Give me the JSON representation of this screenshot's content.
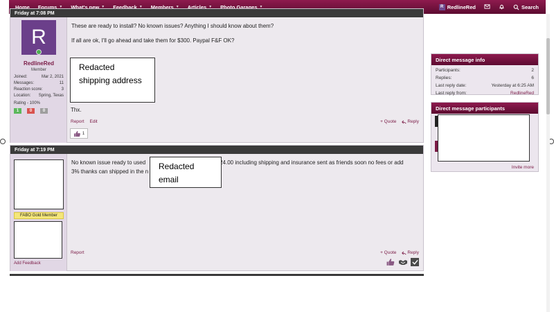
{
  "nav": {
    "items": [
      {
        "label": "Home",
        "dropdown": false
      },
      {
        "label": "Forums",
        "dropdown": true
      },
      {
        "label": "What's new",
        "dropdown": true
      },
      {
        "label": "Feedback",
        "dropdown": true
      },
      {
        "label": "Members",
        "dropdown": true
      },
      {
        "label": "Articles",
        "dropdown": true
      },
      {
        "label": "Photo Garages",
        "dropdown": true
      }
    ],
    "username": "RedlineRed",
    "avatar_letter": "R",
    "search_label": "Search"
  },
  "post1": {
    "header_time": "Friday at 7:08 PM",
    "avatar_letter": "R",
    "username": "RedlineRed",
    "user_title": "Member",
    "stats": [
      {
        "label": "Joined:",
        "value": "Mar 2, 2021"
      },
      {
        "label": "Messages:",
        "value": "11"
      },
      {
        "label": "Reaction score:",
        "value": "3"
      },
      {
        "label": "Location:",
        "value": "Spring, Texas"
      }
    ],
    "rating_text": "Rating - 100%",
    "rating_badges": [
      {
        "value": "1",
        "color": "#5cb85c"
      },
      {
        "value": "0",
        "color": "#d9534f"
      },
      {
        "value": "0",
        "color": "#9e9e9e"
      }
    ],
    "line1": "These are ready to install? No known issues? Anything I should know about them?",
    "line2": "If all are ok, I'll go ahead and take them for $300. Paypal F&F OK?",
    "redacted_label": "Redacted\nshipping address",
    "line3": "Thx.",
    "report_label": "Report",
    "edit_label": "Edit",
    "quote_label": "+ Quote",
    "reply_label": "Reply",
    "reaction_count": "1"
  },
  "post2": {
    "header_time": "Friday at 7:19 PM",
    "text_before": "No known issue ready to used",
    "text_after": "324.00 including shipping and insurance sent as friends soon no fees or add",
    "text_line2": "3% thanks can shipped in the n",
    "redacted_label": "Redacted\nemail",
    "gold_badge": "FABO Gold Member",
    "add_feedback": "Add Feedback",
    "report_label": "Report",
    "quote_label": "+ Quote",
    "reply_label": "Reply"
  },
  "sidebar": {
    "info_title": "Direct message info",
    "info_rows": [
      {
        "label": "Participants:",
        "value": "2",
        "link": false
      },
      {
        "label": "Replies:",
        "value": "6",
        "link": false
      },
      {
        "label": "Last reply date:",
        "value": "Yesterday at 6:25 AM",
        "link": false
      },
      {
        "label": "Last reply from:",
        "value": "RedlineRed",
        "link": true
      }
    ],
    "participants_title": "Direct message participants",
    "invite_label": "Invite more"
  },
  "colors": {
    "brand": "#7a1a45",
    "header_dark": "#3a3a3a",
    "avatar_purple": "#6b3f8a"
  }
}
